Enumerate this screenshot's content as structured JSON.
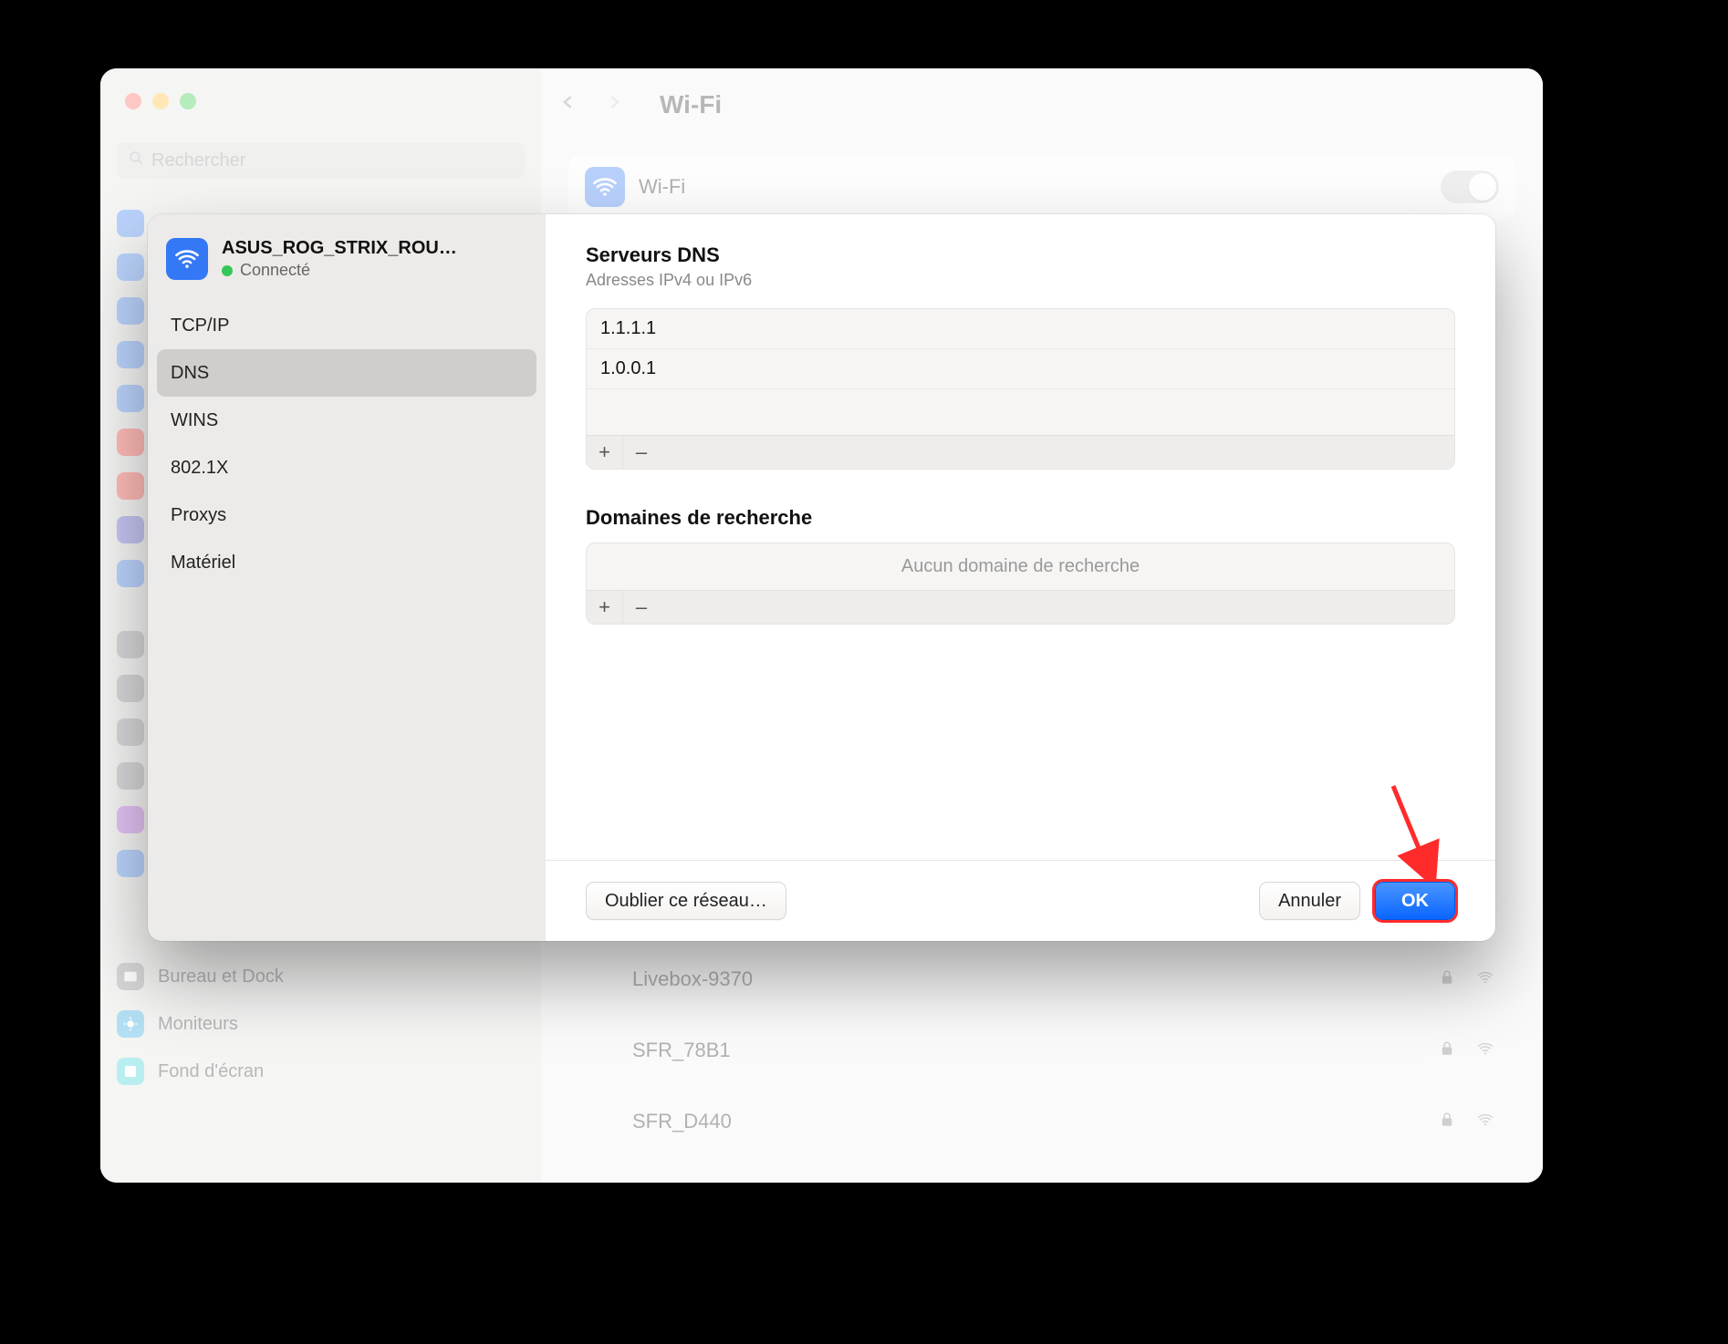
{
  "window": {
    "search_placeholder": "Rechercher",
    "main_title": "Wi-Fi",
    "wifi_section_label": "Wi-Fi",
    "sidebar_below": [
      {
        "label": "Bureau et Dock",
        "icon": "dock",
        "color": "#8e8e93"
      },
      {
        "label": "Moniteurs",
        "icon": "monitor",
        "color": "#2aa7e0"
      },
      {
        "label": "Fond d'écran",
        "icon": "wallpaper",
        "color": "#38cfd7"
      }
    ],
    "networks_below": [
      {
        "name": "Livebox-9370"
      },
      {
        "name": "SFR_78B1"
      },
      {
        "name": "SFR_D440"
      }
    ]
  },
  "modal": {
    "network_name": "ASUS_ROG_STRIX_ROU…",
    "network_status": "Connecté",
    "tabs": [
      {
        "key": "tcpip",
        "label": "TCP/IP"
      },
      {
        "key": "dns",
        "label": "DNS",
        "selected": true
      },
      {
        "key": "wins",
        "label": "WINS"
      },
      {
        "key": "8021x",
        "label": "802.1X"
      },
      {
        "key": "proxies",
        "label": "Proxys"
      },
      {
        "key": "hardware",
        "label": "Matériel"
      }
    ],
    "dns": {
      "title": "Serveurs DNS",
      "subtitle": "Adresses IPv4 ou IPv6",
      "servers": [
        "1.1.1.1",
        "1.0.0.1"
      ],
      "add": "+",
      "remove": "–"
    },
    "search_domains": {
      "title": "Domaines de recherche",
      "empty": "Aucun domaine de recherche",
      "add": "+",
      "remove": "–"
    },
    "footer": {
      "forget": "Oublier ce réseau…",
      "cancel": "Annuler",
      "ok": "OK"
    }
  },
  "annotation": {
    "arrow_color": "#ff0000"
  }
}
